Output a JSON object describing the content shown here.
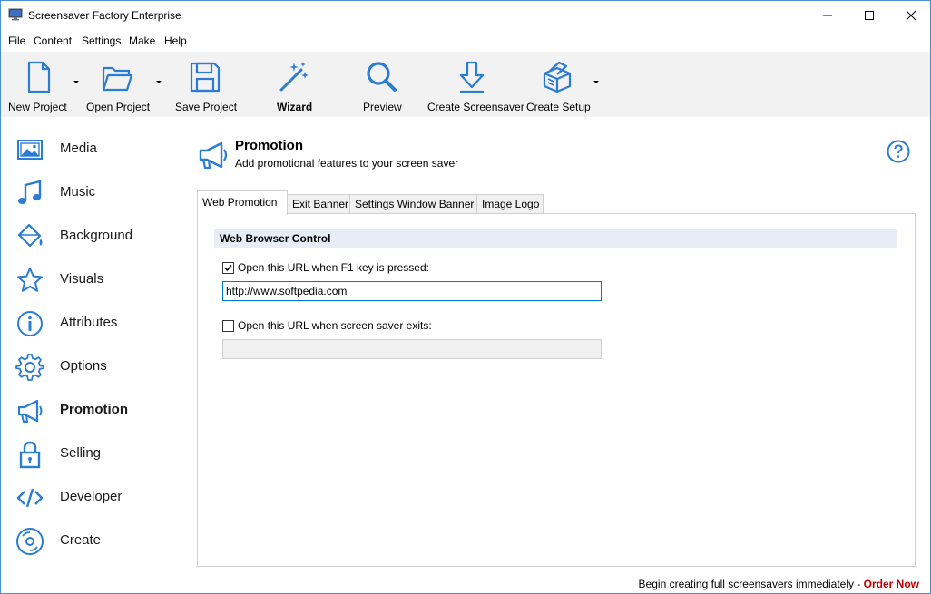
{
  "window": {
    "title": "Screensaver Factory Enterprise",
    "accent": "#2b7cd3"
  },
  "menu": [
    "File",
    "Content",
    "Settings",
    "Make",
    "Help"
  ],
  "toolbar": {
    "new_project": "New Project",
    "open_project": "Open Project",
    "save_project": "Save Project",
    "wizard": "Wizard",
    "preview": "Preview",
    "create_screensaver": "Create Screensaver",
    "create_setup": "Create Setup"
  },
  "sidebar": {
    "items": [
      {
        "label": "Media",
        "icon": "image-icon"
      },
      {
        "label": "Music",
        "icon": "music-note-icon"
      },
      {
        "label": "Background",
        "icon": "paint-bucket-icon"
      },
      {
        "label": "Visuals",
        "icon": "star-icon"
      },
      {
        "label": "Attributes",
        "icon": "info-icon"
      },
      {
        "label": "Options",
        "icon": "gear-icon"
      },
      {
        "label": "Promotion",
        "icon": "megaphone-icon"
      },
      {
        "label": "Selling",
        "icon": "lock-icon"
      },
      {
        "label": "Developer",
        "icon": "code-icon"
      },
      {
        "label": "Create",
        "icon": "disc-icon"
      }
    ],
    "active": "Promotion"
  },
  "page": {
    "title": "Promotion",
    "subtitle": "Add promotional features to your screen saver"
  },
  "tabs": [
    "Web Promotion",
    "Exit Banner",
    "Settings Window Banner",
    "Image Logo"
  ],
  "active_tab": "Web Promotion",
  "web_promotion": {
    "group_title": "Web Browser Control",
    "f1_checkbox_label": "Open this URL when F1 key is pressed:",
    "f1_checked": true,
    "f1_url": "http://www.softpedia.com",
    "exit_checkbox_label": "Open this URL when screen saver exits:",
    "exit_checked": false,
    "exit_url": ""
  },
  "footer": {
    "text": "Begin creating full screensavers immediately - ",
    "link": "Order Now"
  }
}
